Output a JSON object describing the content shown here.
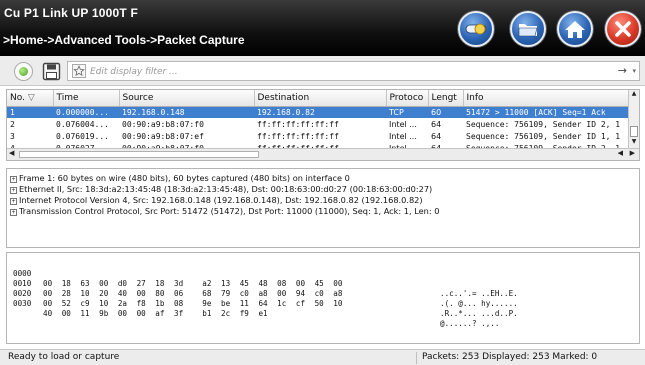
{
  "header": {
    "title": "Cu P1 Link UP 1000T F",
    "breadcrumb": ">Home->Advanced Tools->Packet Capture",
    "buttons": [
      {
        "name": "toggle-button",
        "icon": "toggle-icon",
        "color": "#2c64b4"
      },
      {
        "name": "folder-button",
        "icon": "folder-icon",
        "color": "#2c64b4"
      },
      {
        "name": "home-button",
        "icon": "home-icon",
        "color": "#2c64b4"
      },
      {
        "name": "close-button",
        "icon": "close-icon",
        "color": "#d93a28"
      }
    ]
  },
  "toolbar": {
    "filter_placeholder": "Edit display filter ...",
    "apply_arrow": "→",
    "dropdown_arrow": "▾"
  },
  "packet_list": {
    "columns": [
      "No.",
      "Time",
      "Source",
      "Destination",
      "Protoco",
      "Lengt",
      "Info"
    ],
    "rows": [
      {
        "no": "1",
        "time": "0.000000...",
        "source": "192.168.0.148",
        "destination": "192.168.0.82",
        "protocol": "TCP",
        "length": "60",
        "info": "51472 > 11000 [ACK] Seq=1 Ack",
        "selected": true
      },
      {
        "no": "2",
        "time": "0.076004...",
        "source": "00:90:a9:b8:07:f0",
        "destination": "ff:ff:ff:ff:ff:ff",
        "protocol": "Intel ...",
        "length": "64",
        "info": "Sequence: 756109, Sender ID 2, 1",
        "selected": false
      },
      {
        "no": "3",
        "time": "0.076019...",
        "source": "00:90:a9:b8:07:ef",
        "destination": "ff:ff:ff:ff:ff:ff",
        "protocol": "Intel ...",
        "length": "64",
        "info": "Sequence: 756109, Sender ID 1, 1",
        "selected": false
      },
      {
        "no": "4",
        "time": "0.076027...",
        "source": "00:90:a9:b8:07:f0",
        "destination": "ff:ff:ff:ff:ff:ff",
        "protocol": "Intel ...",
        "length": "64",
        "info": "Sequence: 756109, Sender ID 2, 1",
        "selected": false
      }
    ],
    "selection_color": "#3f7fcf"
  },
  "details": [
    "Frame 1: 60 bytes on wire (480 bits), 60 bytes captured (480 bits) on interface 0",
    "Ethernet II, Src: 18:3d:a2:13:45:48 (18:3d:a2:13:45:48), Dst: 00:18:63:00:d0:27 (00:18:63:00:d0:27)",
    "Internet Protocol Version 4, Src: 192.168.0.148 (192.168.0.148), Dst: 192.168.0.82 (192.168.0.82)",
    "Transmission Control Protocol, Src Port: 51472 (51472), Dst Port: 11000 (11000), Seq: 1, Ack: 1, Len: 0"
  ],
  "hex": [
    {
      "offset": "0000",
      "bytes": "00 18 63 00 d0 27 18 3d  a2 13 45 48 08 00 45 00",
      "ascii": "..c..'.= ..EH..E."
    },
    {
      "offset": "0010",
      "bytes": "00 28 10 20 40 00 80 06  68 79 c0 a8 00 94 c0 a8",
      "ascii": ".(. @... hy......"
    },
    {
      "offset": "0020",
      "bytes": "00 52 c9 10 2a f8 1b 08  9e be 11 64 1c cf 50 10",
      "ascii": ".R..*... ...d..P."
    },
    {
      "offset": "0030",
      "bytes": "40 00 11 9b 00 00 af 3f  b1 2c f9 e1",
      "ascii": "@......? .,.."
    }
  ],
  "status": {
    "left": "Ready to load or capture",
    "right": "Packets: 253 Displayed: 253 Marked: 0"
  }
}
